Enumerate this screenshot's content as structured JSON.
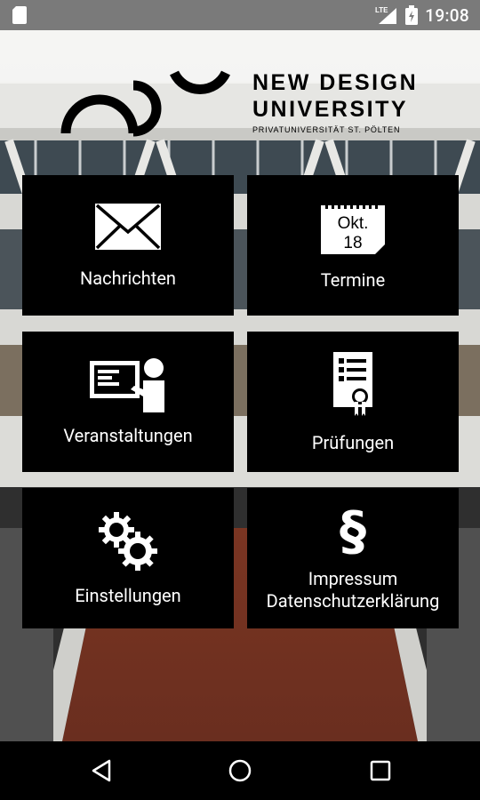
{
  "status_bar": {
    "time": "19:08",
    "network": "LTE",
    "icons": [
      "sd-card-icon",
      "signal-icon",
      "battery-icon"
    ]
  },
  "logo": {
    "line1": "NEW DESIGN",
    "line2": "UNIVERSITY",
    "line3": "PRIVATUNIVERSITÄT ST. PÖLTEN"
  },
  "tiles": [
    {
      "id": "nachrichten",
      "label": "Nachrichten",
      "icon": "envelope-icon"
    },
    {
      "id": "termine",
      "label": "Termine",
      "icon": "calendar-icon",
      "calendar_month": "Okt.",
      "calendar_day": "18"
    },
    {
      "id": "veranstaltungen",
      "label": "Veranstaltungen",
      "icon": "presentation-icon"
    },
    {
      "id": "pruefungen",
      "label": "Prüfungen",
      "icon": "certificate-icon"
    },
    {
      "id": "einstellungen",
      "label": "Einstellungen",
      "icon": "gears-icon"
    },
    {
      "id": "impressum",
      "label_line1": "Impressum",
      "label_line2": "Datenschutzerklärung",
      "icon": "paragraph-icon",
      "glyph": "§"
    }
  ],
  "navbar": {
    "buttons": [
      "back-icon",
      "home-icon",
      "recents-icon"
    ]
  },
  "colors": {
    "tile_bg": "#000000",
    "tile_text": "#ffffff",
    "statusbar_bg": "#7a7a7a",
    "navbar_bg": "#000000"
  }
}
